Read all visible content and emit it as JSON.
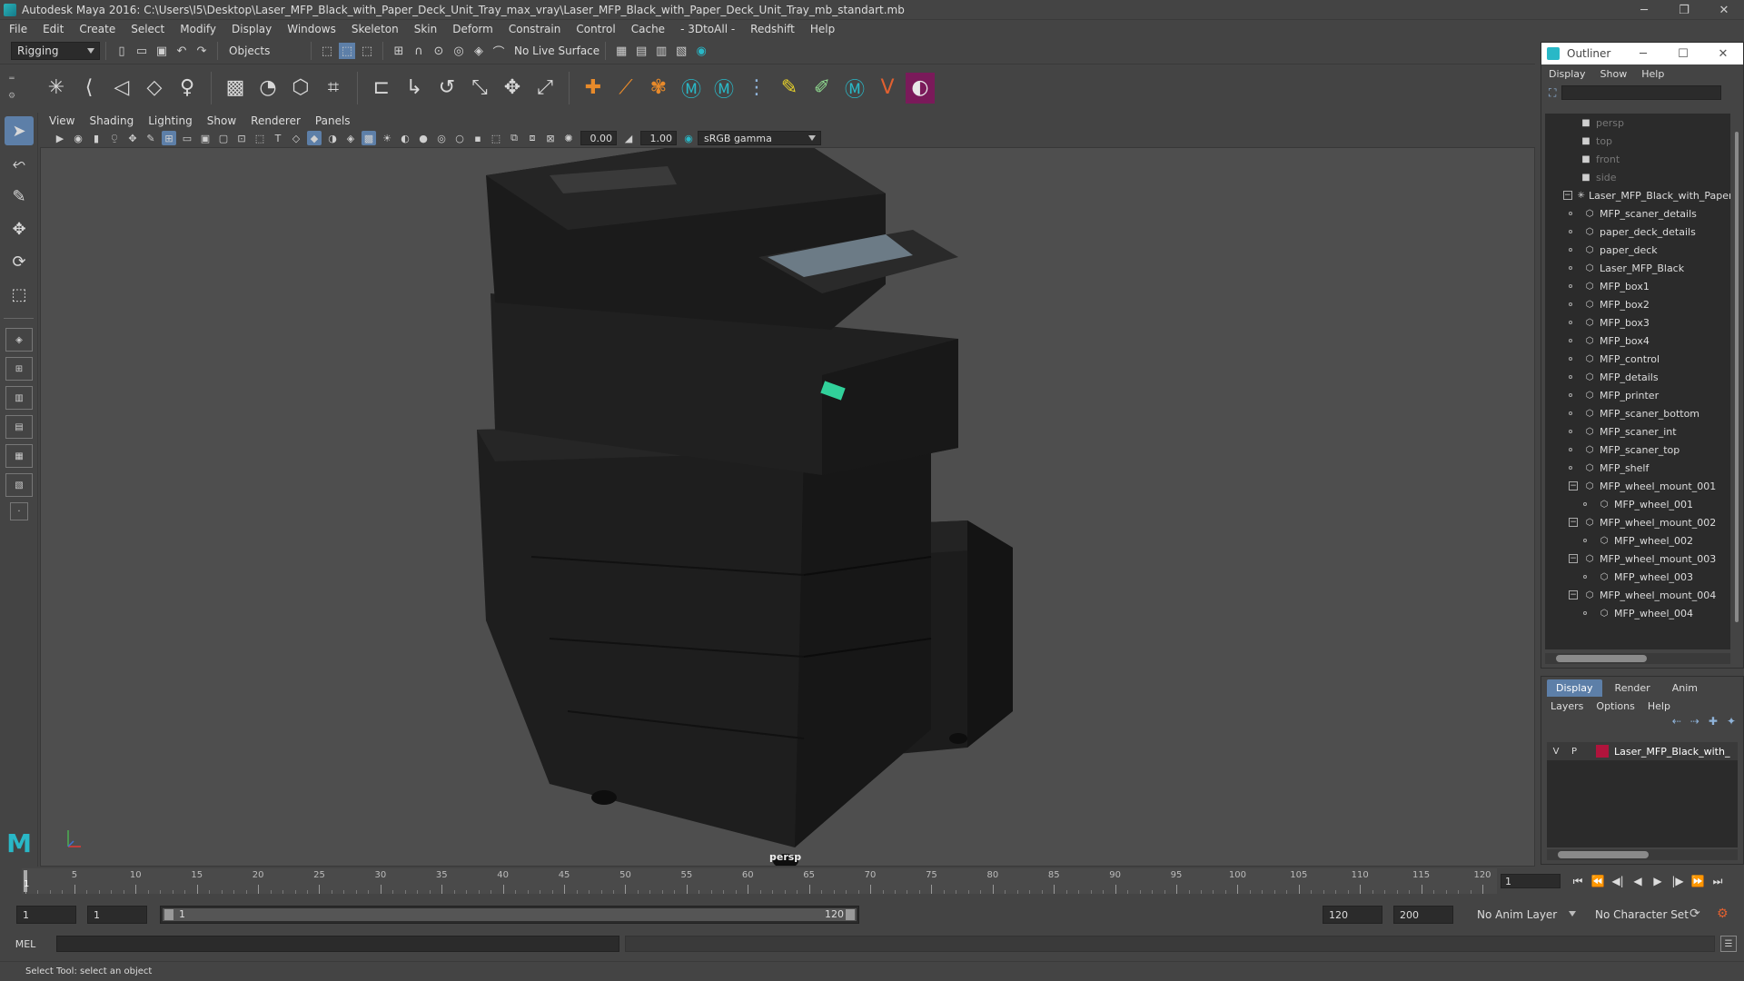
{
  "window": {
    "title": "Autodesk Maya 2016: C:\\Users\\I5\\Desktop\\Laser_MFP_Black_with_Paper_Deck_Unit_Tray_max_vray\\Laser_MFP_Black_with_Paper_Deck_Unit_Tray_mb_standart.mb",
    "minimize": "─",
    "restore": "❐",
    "close": "✕"
  },
  "menubar": [
    "File",
    "Edit",
    "Create",
    "Select",
    "Modify",
    "Display",
    "Windows",
    "Skeleton",
    "Skin",
    "Deform",
    "Constrain",
    "Control",
    "Cache",
    "- 3DtoAll -",
    "Redshift",
    "Help"
  ],
  "statusline": {
    "mode": "Rigging",
    "selection_mask": "Objects",
    "live_surface": "No Live Surface"
  },
  "panel": {
    "menus": [
      "View",
      "Shading",
      "Lighting",
      "Show",
      "Renderer",
      "Panels"
    ],
    "exposure": "0.00",
    "gamma": "1.00",
    "color_space": "sRGB gamma",
    "camera_label": "persp"
  },
  "outliner": {
    "title": "Outliner",
    "menus": [
      "Display",
      "Show",
      "Help"
    ],
    "items": [
      {
        "label": "persp",
        "kind": "camera",
        "depth": 0
      },
      {
        "label": "top",
        "kind": "camera",
        "depth": 0
      },
      {
        "label": "front",
        "kind": "camera",
        "depth": 0
      },
      {
        "label": "side",
        "kind": "camera",
        "depth": 0
      },
      {
        "label": "Laser_MFP_Black_with_Paper",
        "kind": "root",
        "depth": 0
      },
      {
        "label": "MFP_scaner_details",
        "kind": "mesh",
        "depth": 1
      },
      {
        "label": "paper_deck_details",
        "kind": "mesh",
        "depth": 1
      },
      {
        "label": "paper_deck",
        "kind": "mesh",
        "depth": 1
      },
      {
        "label": "Laser_MFP_Black",
        "kind": "mesh",
        "depth": 1
      },
      {
        "label": "MFP_box1",
        "kind": "mesh",
        "depth": 1
      },
      {
        "label": "MFP_box2",
        "kind": "mesh",
        "depth": 1
      },
      {
        "label": "MFP_box3",
        "kind": "mesh",
        "depth": 1
      },
      {
        "label": "MFP_box4",
        "kind": "mesh",
        "depth": 1
      },
      {
        "label": "MFP_control",
        "kind": "mesh",
        "depth": 1
      },
      {
        "label": "MFP_details",
        "kind": "mesh",
        "depth": 1
      },
      {
        "label": "MFP_printer",
        "kind": "mesh",
        "depth": 1
      },
      {
        "label": "MFP_scaner_bottom",
        "kind": "mesh",
        "depth": 1
      },
      {
        "label": "MFP_scaner_int",
        "kind": "mesh",
        "depth": 1
      },
      {
        "label": "MFP_scaner_top",
        "kind": "mesh",
        "depth": 1
      },
      {
        "label": "MFP_shelf",
        "kind": "mesh",
        "depth": 1
      },
      {
        "label": "MFP_wheel_mount_001",
        "kind": "group",
        "depth": 1
      },
      {
        "label": "MFP_wheel_001",
        "kind": "mesh",
        "depth": 2
      },
      {
        "label": "MFP_wheel_mount_002",
        "kind": "group",
        "depth": 1
      },
      {
        "label": "MFP_wheel_002",
        "kind": "mesh",
        "depth": 2
      },
      {
        "label": "MFP_wheel_mount_003",
        "kind": "group",
        "depth": 1
      },
      {
        "label": "MFP_wheel_003",
        "kind": "mesh",
        "depth": 2
      },
      {
        "label": "MFP_wheel_mount_004",
        "kind": "group",
        "depth": 1
      },
      {
        "label": "MFP_wheel_004",
        "kind": "mesh",
        "depth": 2
      }
    ]
  },
  "layer_editor": {
    "tabs": [
      "Display",
      "Render",
      "Anim"
    ],
    "menus": [
      "Layers",
      "Options",
      "Help"
    ],
    "layer": {
      "v": "V",
      "p": "P",
      "name": "Laser_MFP_Black_with_",
      "color": "#b0143c"
    }
  },
  "timeline": {
    "ticks": [
      1,
      5,
      10,
      15,
      20,
      25,
      30,
      35,
      40,
      45,
      50,
      55,
      60,
      65,
      70,
      75,
      80,
      85,
      90,
      95,
      100,
      105,
      110,
      115,
      120
    ],
    "current_frame": "1",
    "current_field": "1"
  },
  "range": {
    "start": "1",
    "playback_start": "1",
    "range_start": "1",
    "range_end": "120",
    "playback_end": "120",
    "end": "200",
    "anim_layer": "No Anim Layer",
    "character_set": "No Character Set"
  },
  "command_line": {
    "label": "MEL"
  },
  "help_line": "Select Tool: select an object"
}
